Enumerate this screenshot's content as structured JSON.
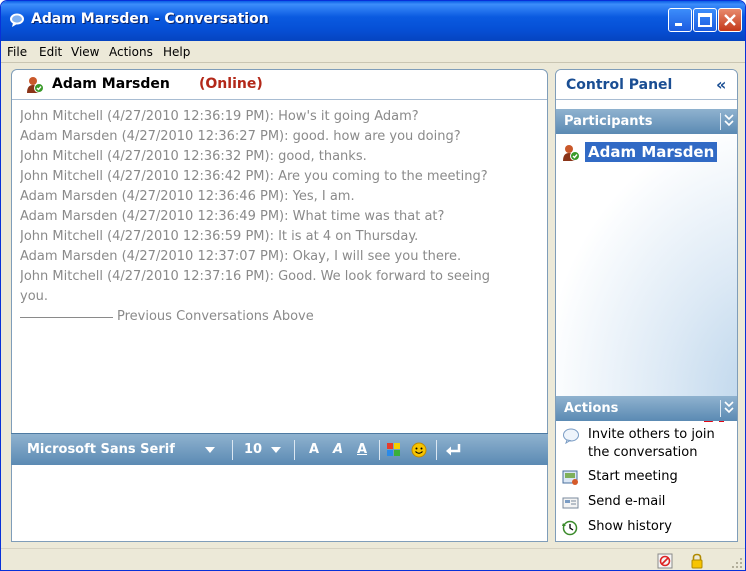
{
  "window": {
    "title": "Adam Marsden - Conversation"
  },
  "menu": {
    "items": [
      "File",
      "Edit",
      "View",
      "Actions",
      "Help"
    ]
  },
  "conversation": {
    "contact_name": "Adam Marsden",
    "contact_status": "(Online)",
    "status_color": "#b32819",
    "history": [
      {
        "text": "John Mitchell  (4/27/2010 12:36:19 PM): How's it going Adam?"
      },
      {
        "text": "Adam Marsden  (4/27/2010 12:36:27 PM): good. how are you doing?"
      },
      {
        "text": "John Mitchell  (4/27/2010 12:36:32 PM): good, thanks."
      },
      {
        "text": "John Mitchell  (4/27/2010 12:36:42 PM): Are you coming to the meeting?"
      },
      {
        "text": "Adam Marsden  (4/27/2010 12:36:46 PM): Yes, I am."
      },
      {
        "text": "Adam Marsden  (4/27/2010 12:36:49 PM): What time was that at?"
      },
      {
        "text": "John Mitchell  (4/27/2010 12:36:59 PM): It is at 4 on Thursday."
      },
      {
        "text": "Adam Marsden  (4/27/2010 12:37:07 PM): Okay, I will see you there."
      },
      {
        "text": "John Mitchell  (4/27/2010 12:37:16 PM): Good. We look forward to seeing you."
      }
    ],
    "separator_text": "Previous Conversations Above"
  },
  "format_toolbar": {
    "font_name": "Microsoft Sans Serif",
    "font_size": "10",
    "bold_label": "A",
    "italic_label": "A",
    "underline_label": "A",
    "color_icon": "color-picker-icon",
    "emoticon_icon": "smiley-icon",
    "send_icon": "enter-arrow-icon"
  },
  "control_panel": {
    "title": "Control Panel",
    "collapse_glyph": "«",
    "participants_label": "Participants",
    "participants": [
      "Adam Marsden"
    ],
    "actions_label": "Actions",
    "actions": [
      {
        "label": "Invite others to join the conversation",
        "icon": "invite-icon"
      },
      {
        "label": "Start meeting",
        "icon": "meeting-icon"
      },
      {
        "label": "Send e-mail",
        "icon": "email-icon"
      },
      {
        "label": "Show history",
        "icon": "history-icon"
      }
    ],
    "section_chevron": "»"
  },
  "colors": {
    "title_bar": "#0a5ae0",
    "panel_header_text": "#1a4e93",
    "toolbar_bar": "#5b8ab3",
    "selection": "#316ac5",
    "history_text": "#8a8a8a",
    "novell_red": "#e30613"
  }
}
